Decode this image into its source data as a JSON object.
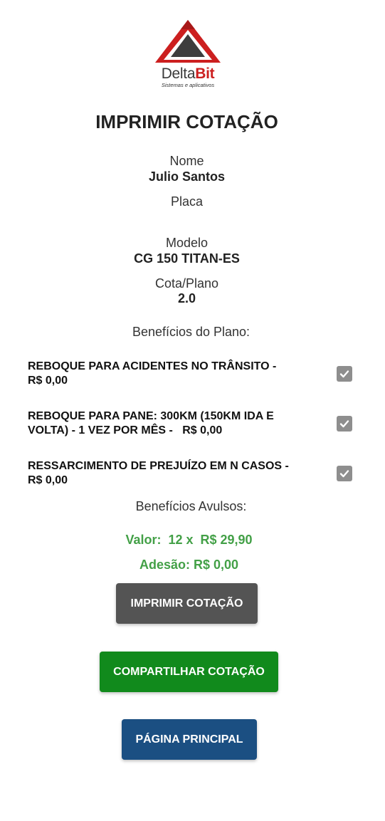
{
  "logo": {
    "word_delta": "Delta",
    "word_bit": "Bit",
    "tagline": "Sistemas e aplicativos"
  },
  "title": "IMPRIMIR COTAÇÃO",
  "fields": {
    "nome_label": "Nome",
    "nome_value": "Julio Santos",
    "placa_label": "Placa",
    "placa_value": "",
    "modelo_label": "Modelo",
    "modelo_value": "CG 150 TITAN-ES",
    "cota_label": "Cota/Plano",
    "cota_value": "2.0"
  },
  "beneficios_plano_label": "Benefícios do Plano:",
  "benefits": [
    {
      "line1": "REBOQUE PARA ACIDENTES NO TRÂNSITO -",
      "line2": "R$ 0,00",
      "checked": true
    },
    {
      "line1": "REBOQUE PARA PANE: 300KM (150KM IDA E",
      "line2": "VOLTA) - 1 VEZ POR MÊS -   R$ 0,00",
      "checked": true
    },
    {
      "line1": "RESSARCIMENTO DE PREJUÍZO EM N CASOS -",
      "line2": "R$ 0,00",
      "checked": true
    }
  ],
  "beneficios_avulsos_label": "Benefícios Avulsos:",
  "valor_text": "Valor:  12 x  R$ 29,90",
  "adesao_text": "Adesão: R$ 0,00",
  "buttons": {
    "print": "IMPRIMIR COTAÇÃO",
    "share": "COMPARTILHAR COTAÇÃO",
    "home": "PÁGINA PRINCIPAL"
  },
  "colors": {
    "accent_red": "#cc1f1f",
    "value_green": "#43a047",
    "print_button": "#545454",
    "share_button": "#118a1c",
    "home_button": "#1b4f82",
    "checkbox": "#8e8e8e"
  }
}
